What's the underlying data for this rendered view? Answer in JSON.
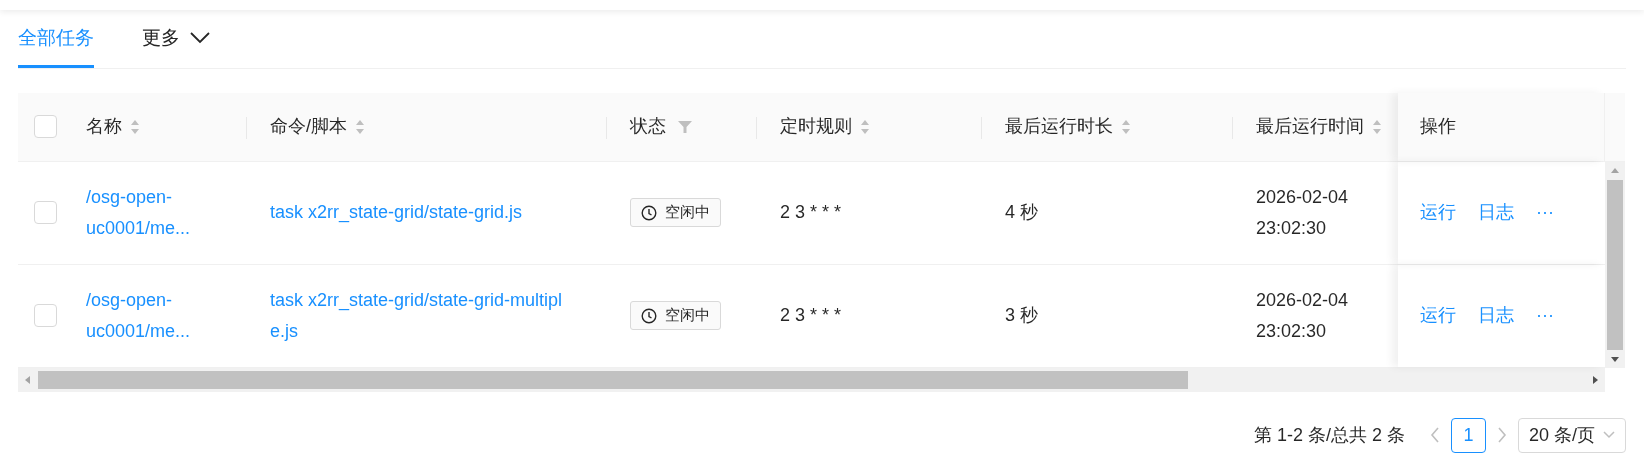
{
  "tabs": [
    {
      "label": "全部任务",
      "selected": true,
      "kind": "tab"
    },
    {
      "label": "更多",
      "selected": false,
      "kind": "dropdown"
    }
  ],
  "table": {
    "select_all": {
      "checked": false
    },
    "columns": [
      {
        "label": "名称",
        "kind": "sortable"
      },
      {
        "label": "命令/脚本",
        "kind": "sortable"
      },
      {
        "label": "状态",
        "kind": "filterable"
      },
      {
        "label": "定时规则",
        "kind": "sortable"
      },
      {
        "label": "最后运行时长",
        "kind": "sortable"
      },
      {
        "label": "最后运行时间",
        "kind": "sortable"
      },
      {
        "label": "操作",
        "kind": "plain"
      }
    ],
    "rows": [
      {
        "checked": false,
        "name": "/osg-open-uc0001/me...",
        "command": "task x2rr_state-grid/state-grid.js",
        "status": "空闲中",
        "rule": "2 3 * * *",
        "duration": "4 秒",
        "last_run": [
          "2026-02-04",
          "23:02:30"
        ],
        "actions": [
          "运行",
          "日志",
          "···"
        ]
      },
      {
        "checked": false,
        "name": "/osg-open-uc0001/me...",
        "command": "task x2rr_state-grid/state-grid-multiple.js",
        "status": "空闲中",
        "rule": "2 3 * * *",
        "duration": "3 秒",
        "last_run": [
          "2026-02-04",
          "23:02:30"
        ],
        "actions": [
          "运行",
          "日志",
          "···"
        ]
      }
    ]
  },
  "pagination": {
    "summary": "第 1-2 条/总共 2 条",
    "pages": [
      {
        "label": "1",
        "selected": true
      }
    ],
    "page_size": "20 条/页"
  }
}
